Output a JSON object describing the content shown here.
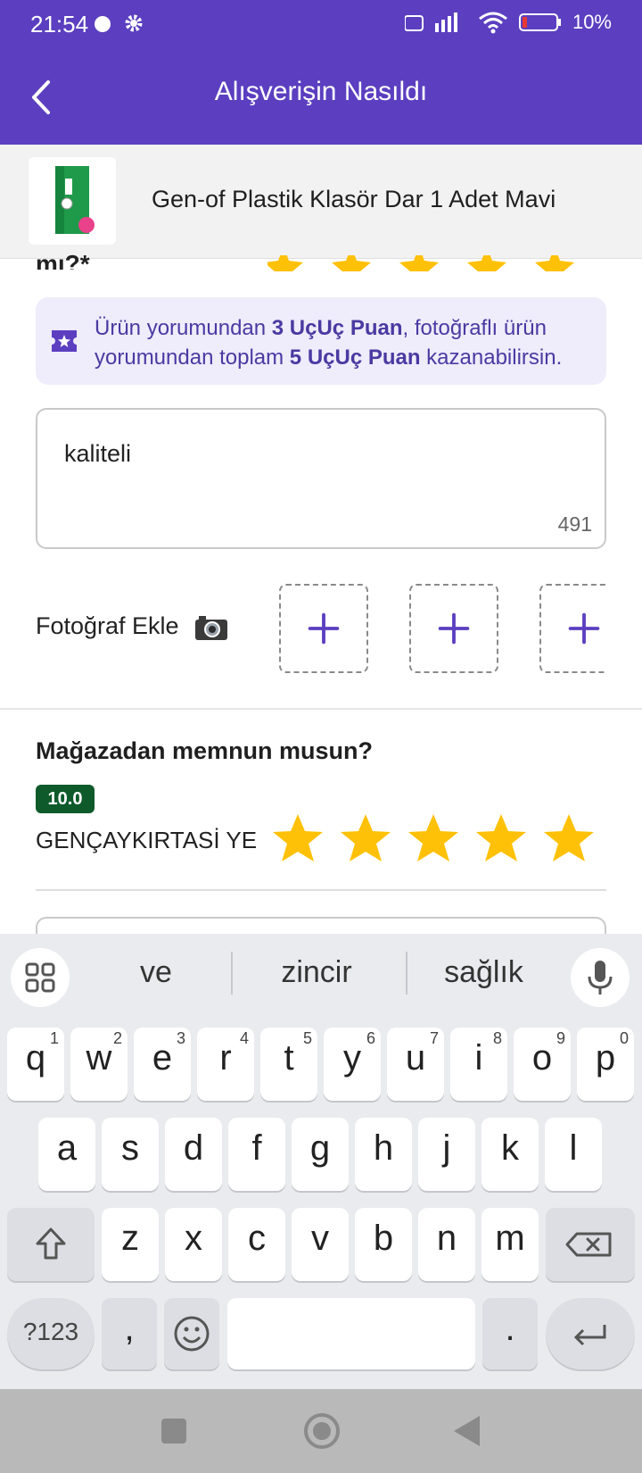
{
  "status_bar": {
    "time": "21:54",
    "battery": "10%"
  },
  "app_bar": {
    "title": "Alışverişin Nasıldı",
    "back_icon": "chevron-left-icon"
  },
  "product": {
    "name": "Gen-of Plastik Klasör Dar 1 Adet Mavi"
  },
  "partial_question": "mı?*",
  "info": {
    "prefix": "Ürün yorumundan ",
    "points1": "3 UçUç Puan",
    "middle": ", fotoğraflı ürün yorumundan toplam ",
    "points2": "5 UçUç Puan",
    "suffix": " kazanabilirsin."
  },
  "review": {
    "value": "kaliteli",
    "remaining": "491"
  },
  "photo": {
    "label": "Fotoğraf Ekle",
    "slots": 3
  },
  "store": {
    "question": "Mağazadan memnun musun?",
    "score": "10.0",
    "name": "GENÇAYKIRTASİ YE",
    "rating": 5
  },
  "keyboard": {
    "suggestions": [
      "ve",
      "zincir",
      "sağlık"
    ],
    "row1": [
      {
        "k": "q",
        "n": "1"
      },
      {
        "k": "w",
        "n": "2"
      },
      {
        "k": "e",
        "n": "3"
      },
      {
        "k": "r",
        "n": "4"
      },
      {
        "k": "t",
        "n": "5"
      },
      {
        "k": "y",
        "n": "6"
      },
      {
        "k": "u",
        "n": "7"
      },
      {
        "k": "i",
        "n": "8"
      },
      {
        "k": "o",
        "n": "9"
      },
      {
        "k": "p",
        "n": "0"
      }
    ],
    "row2": [
      "a",
      "s",
      "d",
      "f",
      "g",
      "h",
      "j",
      "k",
      "l"
    ],
    "row3": [
      "z",
      "x",
      "c",
      "v",
      "b",
      "n",
      "m"
    ],
    "symbols_label": "?123",
    "comma_label": ",",
    "period_label": "."
  },
  "colors": {
    "primary": "#5b3fc0",
    "star": "#ffc107",
    "badge": "#0f5a2b"
  }
}
